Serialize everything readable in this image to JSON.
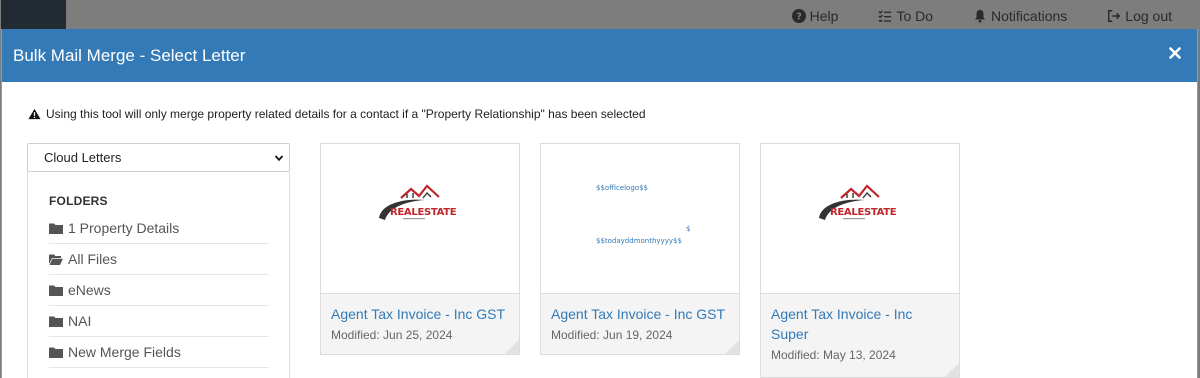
{
  "topnav": {
    "help": "Help",
    "todo": "To Do",
    "notifications": "Notifications",
    "logout": "Log out"
  },
  "modal": {
    "title": "Bulk Mail Merge - Select Letter",
    "notice": "Using this tool will only merge property related details for a contact if a \"Property Relationship\" has been selected",
    "folder_select": "Cloud Letters",
    "folders_heading": "FOLDERS",
    "folders": [
      {
        "label": "1 Property Details",
        "icon": "folder-icon"
      },
      {
        "label": "All Files",
        "icon": "folder-open-icon"
      },
      {
        "label": "eNews",
        "icon": "folder-icon"
      },
      {
        "label": "NAI",
        "icon": "folder-icon"
      },
      {
        "label": "New Merge Fields",
        "icon": "folder-icon"
      }
    ]
  },
  "letters": [
    {
      "name": "Agent Tax Invoice - Inc GST",
      "modified": "Modified: Jun 25, 2024",
      "thumb": "logo",
      "logo_text": "REALESTATE"
    },
    {
      "name": "Agent Tax Invoice - Inc GST",
      "modified": "Modified: Jun 19, 2024",
      "thumb": "merge",
      "merge_1": "$$officelogo$$",
      "merge_2": "$",
      "merge_3": "$$todayddmonthyyyy$$"
    },
    {
      "name": "Agent Tax Invoice - Inc Super",
      "modified": "Modified: May 13, 2024",
      "thumb": "logo",
      "logo_text": "REALESTATE"
    }
  ],
  "colors": {
    "header": "#337ab7",
    "link": "#337ab7",
    "overlay": "#7b7b7b"
  }
}
